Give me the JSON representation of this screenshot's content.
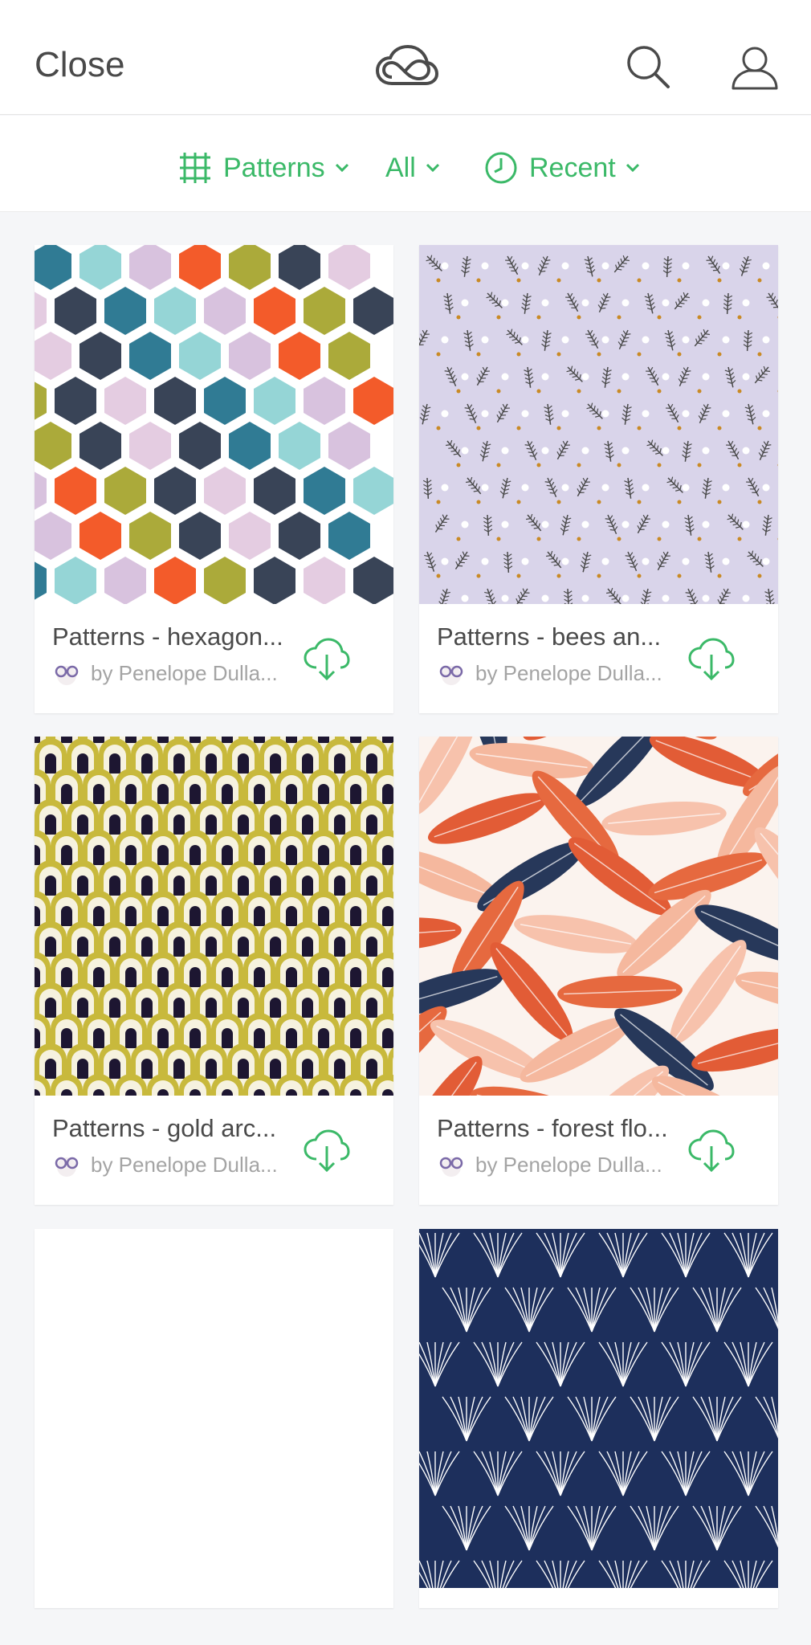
{
  "header": {
    "close_label": "Close",
    "logo_icon": "creative-cloud-icon",
    "search_icon": "search-icon",
    "user_icon": "user-icon"
  },
  "filters": {
    "type_label": "Patterns",
    "scope_label": "All",
    "sort_label": "Recent"
  },
  "colors": {
    "accent": "#3bb968",
    "text_dark": "#4a4a4a",
    "text_muted": "#a4a4a4",
    "background": "#f5f6f8"
  },
  "cards": [
    {
      "title": "Patterns - hexagon...",
      "author": "by Penelope Dulla..."
    },
    {
      "title": "Patterns - bees an...",
      "author": "by Penelope Dulla..."
    },
    {
      "title": "Patterns - gold arc...",
      "author": "by Penelope Dulla..."
    },
    {
      "title": "Patterns - forest flo...",
      "author": "by Penelope Dulla..."
    }
  ]
}
